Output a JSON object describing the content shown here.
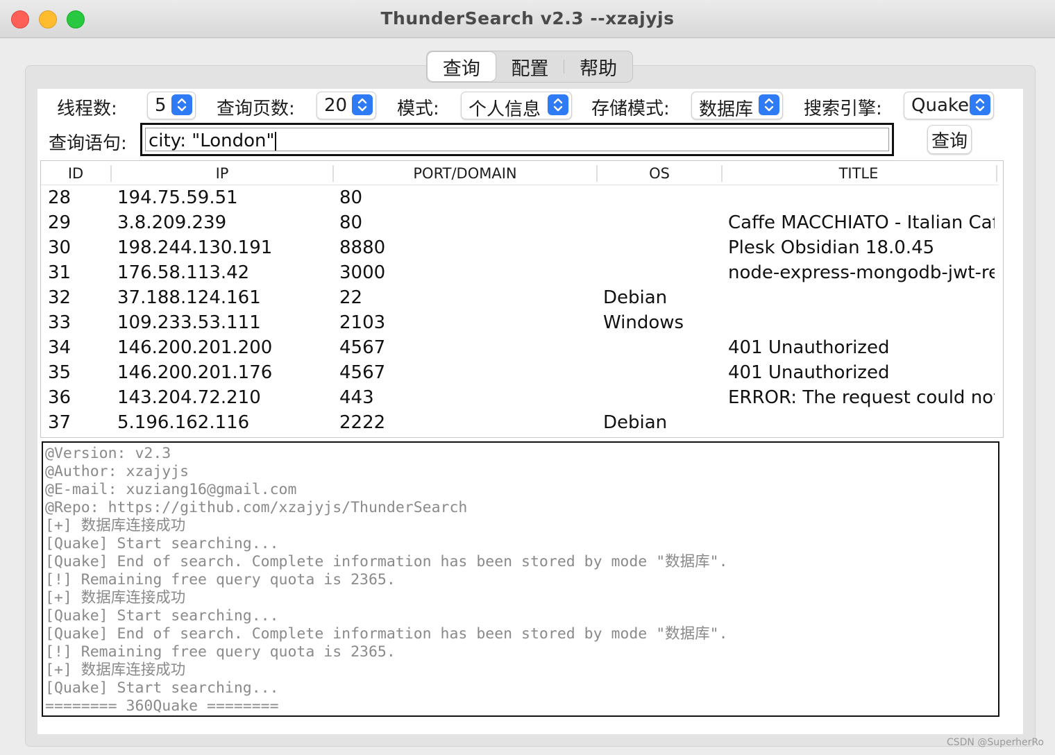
{
  "window": {
    "title": "ThunderSearch v2.3  --xzajyjs"
  },
  "tabs": [
    {
      "label": "查询",
      "active": true
    },
    {
      "label": "配置",
      "active": false
    },
    {
      "label": "帮助",
      "active": false
    }
  ],
  "controls": {
    "threads_label": "线程数:",
    "threads_value": "5",
    "pages_label": "查询页数:",
    "pages_value": "20",
    "mode_label": "模式:",
    "mode_value": "个人信息",
    "storage_label": "存储模式:",
    "storage_value": "数据库",
    "engine_label": "搜索引擎:",
    "engine_value": "Quake",
    "query_label": "查询语句:",
    "query_value": "city: \"London\"",
    "query_button": "查询"
  },
  "table": {
    "columns": [
      "ID",
      "IP",
      "PORT/DOMAIN",
      "OS",
      "TITLE"
    ],
    "rows": [
      [
        "28",
        "194.75.59.51",
        "80",
        "",
        ""
      ],
      [
        "29",
        "3.8.209.239",
        "80",
        "",
        "Caffe MACCHIATO - Italian Caff"
      ],
      [
        "30",
        "198.244.130.191",
        "8880",
        "",
        "Plesk Obsidian 18.0.45"
      ],
      [
        "31",
        "176.58.113.42",
        "3000",
        "",
        "node-express-mongodb-jwt-res"
      ],
      [
        "32",
        "37.188.124.161",
        "22",
        "Debian",
        ""
      ],
      [
        "33",
        "109.233.53.111",
        "2103",
        "Windows",
        ""
      ],
      [
        "34",
        "146.200.201.200",
        "4567",
        "",
        "401 Unauthorized"
      ],
      [
        "35",
        "146.200.201.176",
        "4567",
        "",
        "401 Unauthorized"
      ],
      [
        "36",
        "143.204.72.210",
        "443",
        "",
        "ERROR: The request could not b"
      ],
      [
        "37",
        "5.196.162.116",
        "2222",
        "Debian",
        ""
      ]
    ]
  },
  "log": [
    "@Version: v2.3",
    "@Author: xzajyjs",
    "@E-mail: xuziang16@gmail.com",
    "@Repo: https://github.com/xzajyjs/ThunderSearch",
    "[+] 数据库连接成功",
    "[Quake] Start searching...",
    "[Quake] End of search. Complete information has been stored by mode \"数据库\".",
    "[!] Remaining free query quota is 2365.",
    "[+] 数据库连接成功",
    "[Quake] Start searching...",
    "[Quake] End of search. Complete information has been stored by mode \"数据库\".",
    "[!] Remaining free query quota is 2365.",
    "[+] 数据库连接成功",
    "[Quake] Start searching...",
    "======== 360Quake ========"
  ],
  "watermark": "CSDN @SuperherRo",
  "colors": {
    "accent": "#2f7bf5",
    "close": "#fe5f57",
    "minimize": "#febc2e",
    "maximize": "#28c840"
  }
}
